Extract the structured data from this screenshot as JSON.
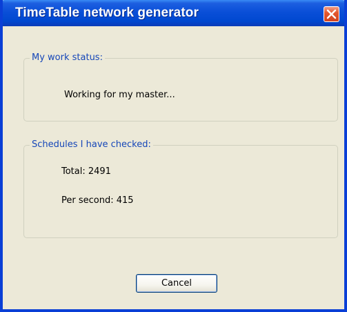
{
  "window": {
    "title": "TimeTable network generator",
    "close_symbol": "×"
  },
  "work_status": {
    "legend": "My work status:",
    "text": "Working for my master..."
  },
  "schedules": {
    "legend": "Schedules I have checked:",
    "total": "Total: 2491",
    "per_second": "Per second: 415"
  },
  "actions": {
    "cancel_label": "Cancel"
  },
  "colors": {
    "titlebar": "#0a4fd8",
    "window_face": "#ece9d8",
    "legend_text": "#1546b8",
    "close_button": "#e3582f"
  },
  "icons": {
    "close": "close-icon"
  }
}
